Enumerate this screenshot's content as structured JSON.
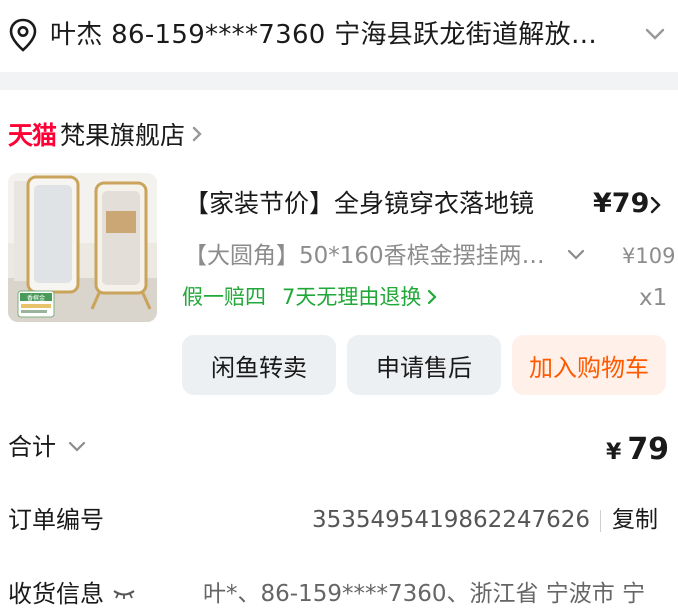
{
  "address": {
    "text": "叶杰  86-159****7360  宁海县跃龙街道解放…",
    "icon": "location-pin-icon"
  },
  "shop": {
    "brand": "天猫",
    "name": "梵果旗舰店"
  },
  "product": {
    "title": "【家装节价】全身镜穿衣落地镜",
    "price": "¥79",
    "sku": "【大圆角】50*160香槟金摆挂两…",
    "original_price": "¥109",
    "tags": [
      "假一赔四",
      "7天无理由退换"
    ],
    "quantity": "x1",
    "image_badge": "香槟金"
  },
  "actions": {
    "resell": "闲鱼转卖",
    "after_sale": "申请售后",
    "add_to_cart": "加入购物车"
  },
  "summary": {
    "total_label": "合计",
    "currency": "¥",
    "total_value": "79",
    "order_label": "订单编号",
    "order_number": "3535495419862247626",
    "copy_label": "复制",
    "receiver_label": "收货信息",
    "receiver_value": "叶*、86-159****7360、浙江省 宁波市 宁"
  },
  "colors": {
    "tmall_red": "#ff0036",
    "accent_orange": "#ff5a00",
    "tag_green": "#22a838"
  }
}
